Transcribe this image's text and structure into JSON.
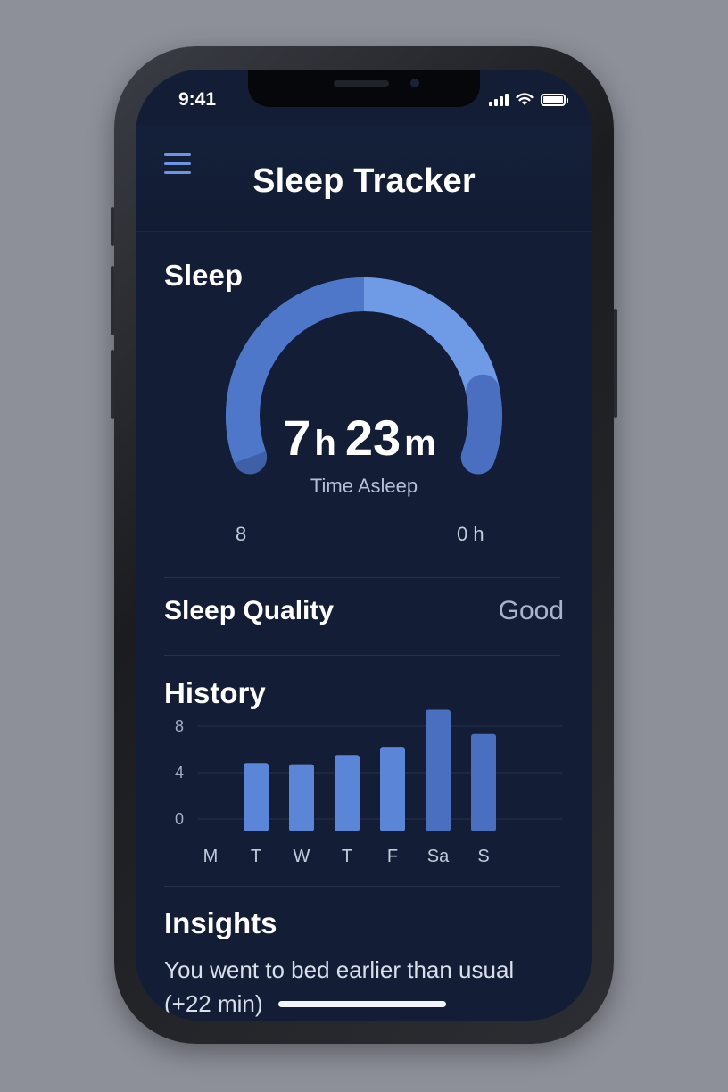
{
  "status_bar": {
    "time": "9:41"
  },
  "header": {
    "title": "Sleep Tracker"
  },
  "sleep": {
    "title": "Sleep",
    "hours": "7",
    "hours_unit": "h",
    "minutes": "23",
    "minutes_unit": "m",
    "caption": "Time Asleep",
    "left_label": "8",
    "right_label": "0 h",
    "progress_fraction": 0.92
  },
  "quality": {
    "label": "Sleep Quality",
    "value": "Good"
  },
  "history": {
    "title": "History",
    "chart_data": {
      "type": "bar",
      "categories": [
        "M",
        "T",
        "W",
        "T",
        "F",
        "Sa",
        "S"
      ],
      "values": [
        null,
        5.9,
        5.8,
        6.6,
        7.3,
        10.5,
        8.4
      ],
      "ylim": [
        0,
        10.5
      ],
      "yticks": [
        "8",
        "4",
        "0"
      ],
      "ytick_values": [
        8,
        4,
        0
      ],
      "grid": true,
      "colors": [
        "#5b86d8",
        "#5b86d8",
        "#5b86d8",
        "#5b86d8",
        "#4a6fc0",
        "#4a6fc0"
      ]
    }
  },
  "insights": {
    "title": "Insights",
    "text": "You went to bed earlier than usual (+22 min)"
  },
  "colors": {
    "background": "#131d35",
    "accent": "#5b86d8",
    "accent_dark": "#4a6fc0",
    "accent_light": "#6f9be6"
  }
}
